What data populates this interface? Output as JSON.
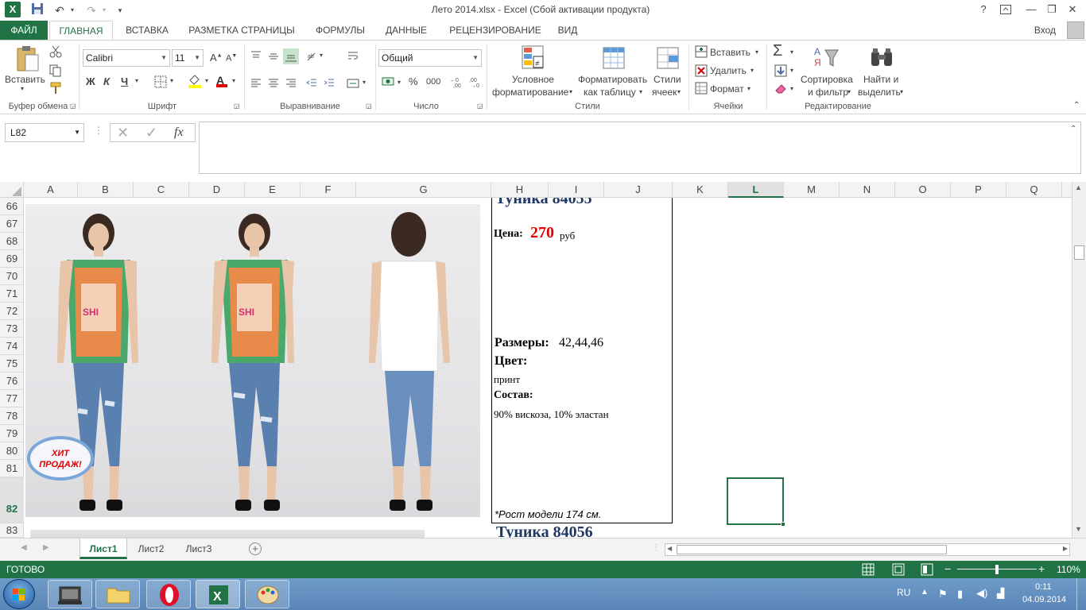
{
  "window": {
    "title": "Лето 2014.xlsx - Excel (Сбой активации продукта)",
    "help": "?",
    "minimize": "—",
    "restore": "❐",
    "close": "✕"
  },
  "qat": {
    "save_icon": "save-icon",
    "undo_icon": "undo-icon",
    "redo_icon": "redo-icon",
    "customize": "▾"
  },
  "ribbon_tabs": [
    "ФАЙЛ",
    "ГЛАВНАЯ",
    "ВСТАВКА",
    "РАЗМЕТКА СТРАНИЦЫ",
    "ФОРМУЛЫ",
    "ДАННЫЕ",
    "РЕЦЕНЗИРОВАНИЕ",
    "ВИД"
  ],
  "user": {
    "login": "Вход"
  },
  "ribbon": {
    "clipboard": {
      "paste": "Вставить",
      "label": "Буфер обмена"
    },
    "font": {
      "name": "Calibri",
      "size": "11",
      "bold": "Ж",
      "italic": "К",
      "underline": "Ч",
      "label": "Шрифт"
    },
    "alignment": {
      "label": "Выравнивание"
    },
    "number": {
      "format": "Общий",
      "label": "Число",
      "percent": "%",
      "thousands": "000"
    },
    "styles": {
      "conditional_1": "Условное",
      "conditional_2": "форматирование",
      "table_1": "Форматировать",
      "table_2": "как таблицу",
      "cell_1": "Стили",
      "cell_2": "ячеек",
      "label": "Стили"
    },
    "cells": {
      "insert": "Вставить",
      "delete": "Удалить",
      "format": "Формат",
      "label": "Ячейки"
    },
    "editing": {
      "sort_1": "Сортировка",
      "sort_2": "и фильтр",
      "find_1": "Найти и",
      "find_2": "выделить",
      "label": "Редактирование"
    }
  },
  "formula_bar": {
    "name_box": "L82",
    "fx": "fx",
    "value": ""
  },
  "columns": [
    "A",
    "B",
    "C",
    "D",
    "E",
    "F",
    "G",
    "H",
    "I",
    "J",
    "K",
    "L",
    "M",
    "N",
    "O",
    "P",
    "Q"
  ],
  "rows": [
    "66",
    "67",
    "68",
    "69",
    "70",
    "71",
    "72",
    "73",
    "74",
    "75",
    "76",
    "77",
    "78",
    "79",
    "80",
    "81",
    "82",
    "83"
  ],
  "selected_cell": {
    "column": "L",
    "row": "82"
  },
  "product": {
    "title_top": "Туника 84055",
    "price_label": "Цена:",
    "price_value": "270",
    "price_unit": "руб",
    "sizes_label": "Размеры:",
    "sizes_value": "42,44,46",
    "color_label": "Цвет:",
    "color_value": "принт",
    "composition_label": "Состав:",
    "composition_value": "90% вискоза, 10% эластан",
    "model_note": "*Рост модели 174 см.",
    "next_title": "Туника 84056"
  },
  "badge": {
    "line1": "ХИТ",
    "line2": "ПРОДАЖ!"
  },
  "sheets": [
    "Лист1",
    "Лист2",
    "Лист3"
  ],
  "active_sheet": "Лист1",
  "status": {
    "state": "ГОТОВО",
    "zoom": "110%"
  },
  "taskbar": {
    "lang": "RU",
    "time": "0:11",
    "date": "04.09.2014",
    "apps": [
      "start-orb-icon",
      "virtual-machine-icon",
      "explorer-folder-icon",
      "opera-icon",
      "excel-icon",
      "paint-icon"
    ]
  },
  "colors": {
    "excel_green": "#217346",
    "price_red": "#e00000",
    "title_navy": "#1f3864",
    "badge_blue": "#7aa6d8"
  }
}
